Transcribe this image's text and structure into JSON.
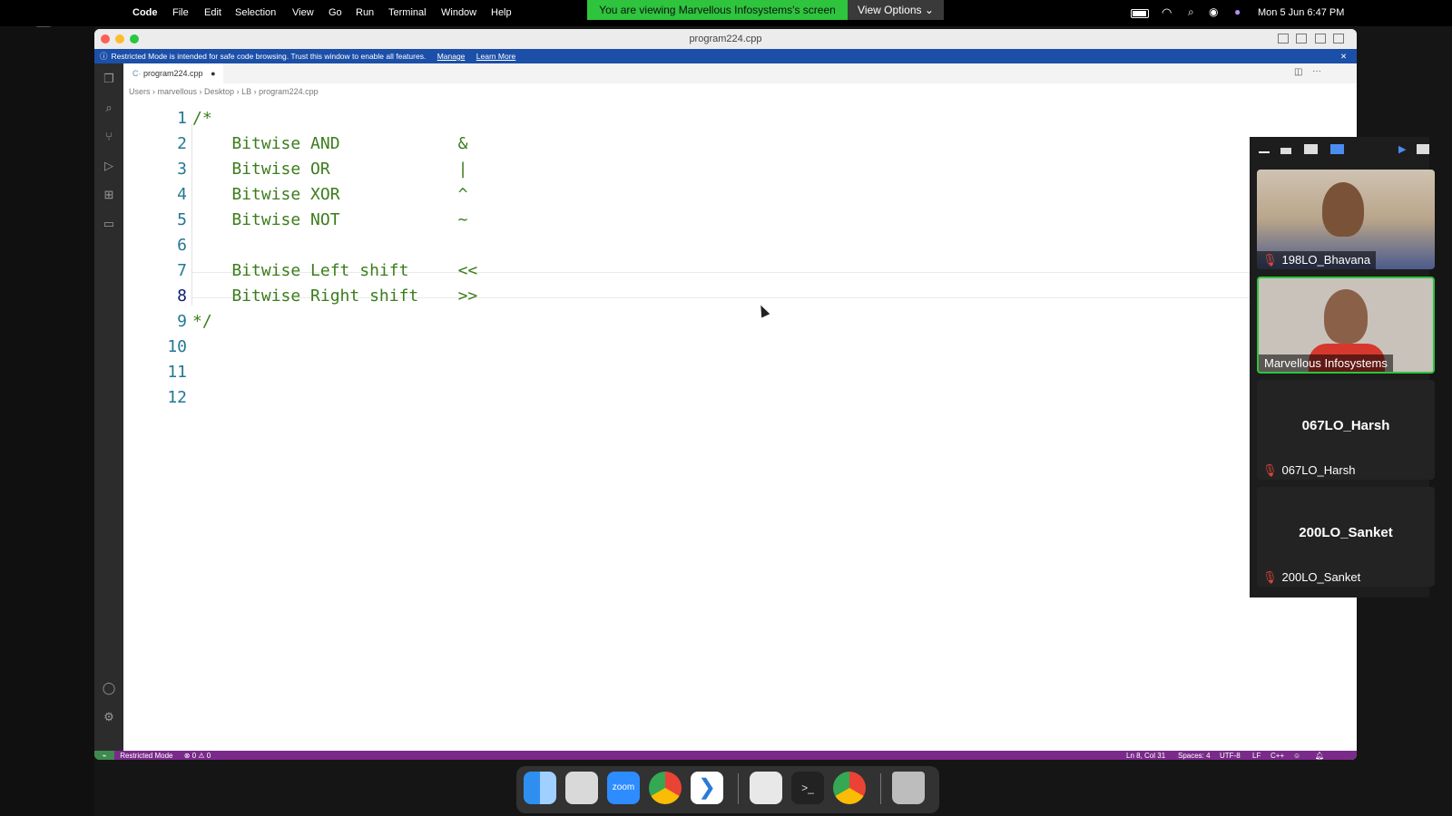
{
  "menubar": {
    "app_name": "Code",
    "menus": [
      "File",
      "Edit",
      "Selection",
      "View",
      "Go",
      "Run",
      "Terminal",
      "Window",
      "Help"
    ],
    "share_banner": "You are viewing Marvellous Infosystems's screen",
    "view_options": "View Options",
    "clock": "Mon 5 Jun  6:47 PM"
  },
  "window": {
    "title": "program224.cpp",
    "restricted_notice": "Restricted Mode is intended for safe code browsing. Trust this window to enable all features.",
    "manage_link": "Manage",
    "learn_more_link": "Learn More",
    "tab_label": "program224.cpp",
    "breadcrumb": [
      "Users",
      "marvellous",
      "Desktop",
      "LB",
      "program224.cpp"
    ]
  },
  "editor": {
    "line_numbers": [
      "1",
      "2",
      "3",
      "4",
      "5",
      "6",
      "7",
      "8",
      "9",
      "10",
      "11",
      "12"
    ],
    "lines": [
      "/*",
      "    Bitwise AND            &",
      "    Bitwise OR             |",
      "    Bitwise XOR            ^",
      "    Bitwise NOT            ~",
      "",
      "    Bitwise Left shift     <<",
      "    Bitwise Right shift    >>",
      "*/",
      "",
      "",
      ""
    ],
    "active_line": 8
  },
  "statusbar": {
    "restricted": "Restricted Mode",
    "problems": "⊗ 0 ⚠ 0",
    "position": "Ln 8, Col 31",
    "spaces": "Spaces: 4",
    "encoding": "UTF-8",
    "eol": "LF",
    "language": "C++"
  },
  "participants": [
    {
      "name": "198LO_Bhavana",
      "muted": true,
      "video": true
    },
    {
      "name": "Marvellous Infosystems",
      "muted": false,
      "video": true
    },
    {
      "name": "067LO_Harsh",
      "muted": true,
      "video": false
    },
    {
      "name": "200LO_Sanket",
      "muted": true,
      "video": false
    }
  ],
  "colors": {
    "code_green": "#3b7d1c",
    "line_number_blue": "#237893",
    "restricted_blue": "#1c4fa8",
    "status_purple": "#7a2a8a",
    "share_banner_green": "#2ec43d",
    "active_speaker_border": "#2ec43d"
  }
}
